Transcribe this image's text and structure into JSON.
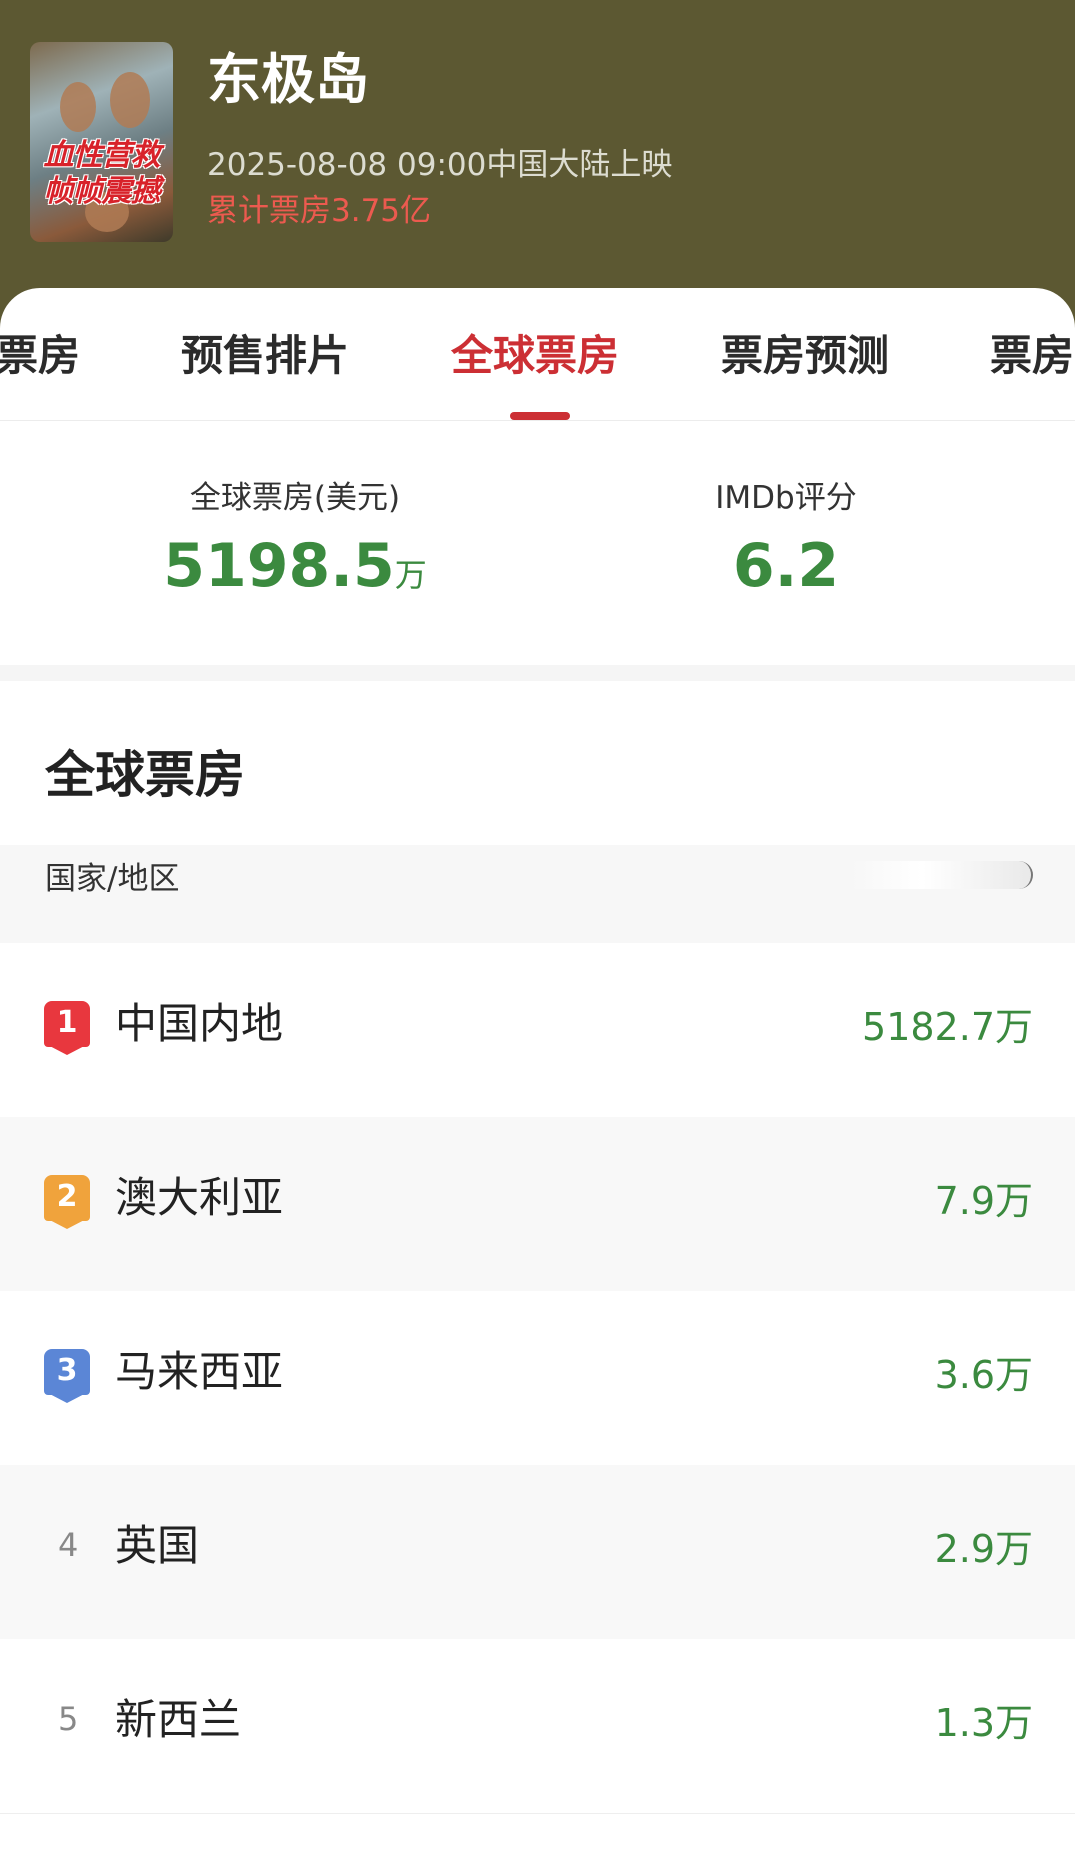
{
  "movie": {
    "title": "东极岛",
    "release": "2025-08-08 09:00中国大陆上映",
    "cumulative_box_office": "累计票房3.75亿",
    "poster_slogan": "血性营救\n帧帧震撼"
  },
  "tabs": [
    {
      "label": "票房"
    },
    {
      "label": "预售排片"
    },
    {
      "label": "全球票房",
      "active": true
    },
    {
      "label": "票房预测"
    },
    {
      "label": "票房"
    }
  ],
  "stats": {
    "global_label": "全球票房(美元)",
    "global_value": "5198.5",
    "global_unit": "万",
    "imdb_label": "IMDb评分",
    "imdb_value": "6.2"
  },
  "section": {
    "title": "全球票房",
    "col_country": "国家/地区",
    "col_value": ""
  },
  "rows": [
    {
      "rank": "1",
      "country": "中国内地",
      "value": "5182.7万",
      "badge_color": "#e8373e"
    },
    {
      "rank": "2",
      "country": "澳大利亚",
      "value": "7.9万",
      "badge_color": "#f0a33c"
    },
    {
      "rank": "3",
      "country": "马来西亚",
      "value": "3.6万",
      "badge_color": "#5b86d6"
    },
    {
      "rank": "4",
      "country": "英国",
      "value": "2.9万"
    },
    {
      "rank": "5",
      "country": "新西兰",
      "value": "1.3万"
    }
  ],
  "colors": {
    "header_bg": "#5c5832",
    "accent_red": "#cc2f34",
    "value_green": "#3b8a3f"
  }
}
